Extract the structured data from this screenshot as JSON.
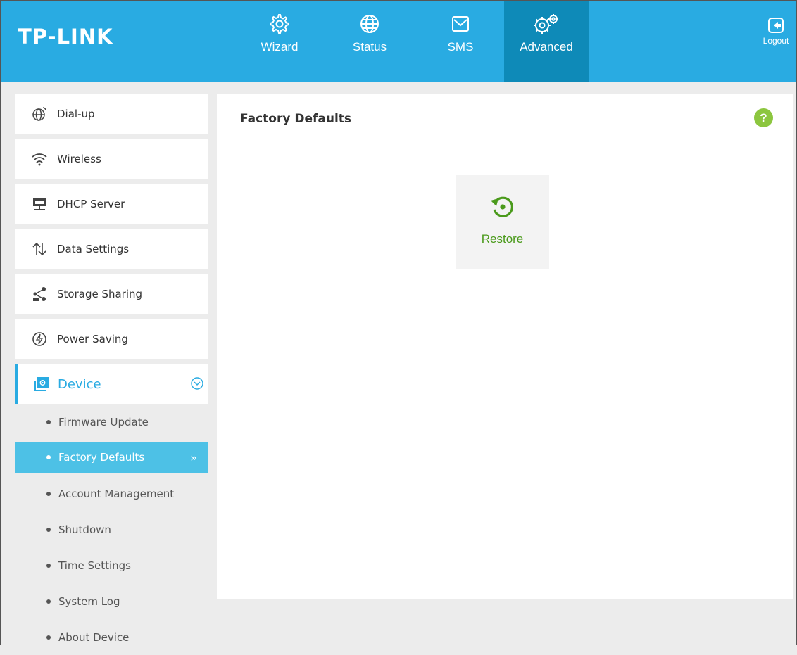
{
  "header": {
    "logo": "TP-LINK",
    "nav": [
      {
        "label": "Wizard",
        "icon": "gear-icon"
      },
      {
        "label": "Status",
        "icon": "globe-icon"
      },
      {
        "label": "SMS",
        "icon": "envelope-icon"
      },
      {
        "label": "Advanced",
        "icon": "gears-icon",
        "active": true
      }
    ],
    "logout": "Logout"
  },
  "sidebar": {
    "items": [
      {
        "label": "Dial-up",
        "icon": "globe-dial-icon"
      },
      {
        "label": "Wireless",
        "icon": "wifi-icon"
      },
      {
        "label": "DHCP Server",
        "icon": "server-icon"
      },
      {
        "label": "Data Settings",
        "icon": "updown-arrows-icon"
      },
      {
        "label": "Storage Sharing",
        "icon": "share-icon"
      },
      {
        "label": "Power Saving",
        "icon": "power-saving-icon"
      }
    ],
    "device": {
      "label": "Device",
      "icon": "device-settings-icon",
      "expanded": true,
      "subitems": [
        {
          "label": "Firmware Update"
        },
        {
          "label": "Factory Defaults",
          "active": true
        },
        {
          "label": "Account Management"
        },
        {
          "label": "Shutdown"
        },
        {
          "label": "Time Settings"
        },
        {
          "label": "System Log"
        },
        {
          "label": "About Device"
        }
      ]
    }
  },
  "main": {
    "title": "Factory Defaults",
    "help": "?",
    "restore_label": "Restore"
  },
  "colors": {
    "header_bg": "#29abe2",
    "nav_active": "#0e8ab8",
    "sub_active": "#4dc1e6",
    "accent_green": "#4a9a1b",
    "help_green": "#8cc63f"
  }
}
